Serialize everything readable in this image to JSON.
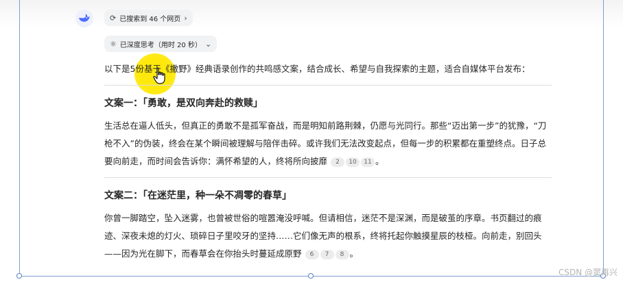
{
  "search_pill": {
    "label": "已搜索到 46 个网页",
    "chevron": "›"
  },
  "think_pill": {
    "label": "已深度思考（用时 20 秒）",
    "chevron": "⌄"
  },
  "intro": "以下是5份基于《撒野》经典语录创作的共鸣感文案，结合成长、希望与自我探索的主题，适合自媒体平台发布：",
  "sections": [
    {
      "title": "文案一：「勇敢，是双向奔赴的救赎」",
      "body": "生活总在逼人低头，但真正的勇敢不是孤军奋战，而是明知前路荆棘，仍愿与光同行。那些“迈出第一步”的犹豫，“刀枪不入”的伪装，终会在某个瞬间被理解与陪伴击碎。或许我们无法改变起点，但每一步的积累都在重塑终点。日子总要向前走，而时间会告诉你：满怀希望的人，终将所向披靡",
      "citations": [
        "2",
        "10",
        "11"
      ],
      "end": "。"
    },
    {
      "title": "文案二：「在迷茫里，种一朵不凋零的春草」",
      "body": "你曾一脚踏空，坠入迷雾，也曾被世俗的喧嚣淹没呼喊。但请相信，迷茫不是深渊，而是破茧的序章。书页翻过的痕迹、深夜未熄的灯火、琐碎日子里咬牙的坚持……它们像无声的根系，终将托起你触摸星辰的枝桠。向前走，别回头——因为光在脚下，而春草会在你抬头时蔓延成原野",
      "citations": [
        "6",
        "7",
        "8"
      ],
      "end": "。"
    }
  ],
  "watermark": "CSDN @窦再兴",
  "colors": {
    "accent_blue": "#4d6bfe",
    "highlight_yellow": "#ffe800",
    "text": "#262626"
  },
  "icons": {
    "avatar": "deepseek-whale-icon",
    "search": "refresh-search-icon",
    "think": "atom-think-icon",
    "cursor": "hand-pointer-icon"
  }
}
